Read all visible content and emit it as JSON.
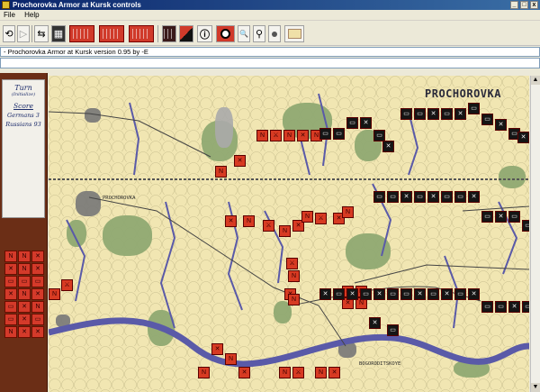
{
  "window": {
    "title": "Prochorovka Armor at Kursk controls",
    "min": "_",
    "max": "□",
    "close": "x"
  },
  "menu": {
    "file": "File",
    "help": "Help"
  },
  "toolbar": {
    "undo": "⟲",
    "step": "▷",
    "swap": "⇆",
    "counters": "▦",
    "zoom": "🔍",
    "marker": "⚲",
    "info": "ⓘ"
  },
  "message": "- Prochorovka Armor at Kursk version 0.95 by -E",
  "turn_card": {
    "turn": "Turn",
    "sub": "(Initialize)",
    "score": "Score",
    "germans": "Germans 3",
    "russians": "Russians 93"
  },
  "map": {
    "title": "PROCHOROVKA",
    "town1": "PROCHOROVKA",
    "town2": "BOGORODITSKOYE"
  },
  "counters": {
    "german": [
      "N",
      "✕",
      "N",
      "⚔",
      "N",
      "✕",
      "N",
      "✕",
      "N",
      "⚔",
      "N",
      "✕",
      "N",
      "⚔",
      "✕",
      "N",
      "✕",
      "N",
      "⚔",
      "N",
      "✕",
      "N",
      "✕",
      "N",
      "⚔",
      "N",
      "✕",
      "N",
      "⚔",
      "N",
      "✕",
      "N",
      "N",
      "✕"
    ],
    "russian": [
      "▭",
      "▭",
      "▭",
      "✕",
      "▭",
      "✕",
      "▭",
      "▭",
      "✕",
      "▭",
      "✕",
      "▭",
      "▭",
      "✕",
      "▭",
      "✕",
      "▭",
      "▭",
      "✕",
      "▭",
      "✕",
      "▭",
      "▭",
      "✕",
      "▭",
      "✕",
      "▭",
      "▭",
      "✕",
      "▭",
      "✕",
      "▭",
      "✕",
      "▭",
      "▭",
      "✕",
      "▭",
      "✕",
      "▭",
      "✕",
      "▭",
      "▭",
      "✕",
      "▭",
      "✕",
      "▭"
    ]
  },
  "side_counters": [
    "N",
    "N",
    "✕",
    "✕",
    "N",
    "✕",
    "▭",
    "▭",
    "▭",
    "✕",
    "N",
    "✕",
    "▭",
    "✕",
    "N",
    "▭",
    "✕",
    "▭",
    "N",
    "✕",
    "✕"
  ],
  "colors": {
    "german": "#d73a22",
    "russian": "#151515",
    "map": "#f1e6b2",
    "forest": "#8fa972",
    "river": "#5a5aa8"
  }
}
